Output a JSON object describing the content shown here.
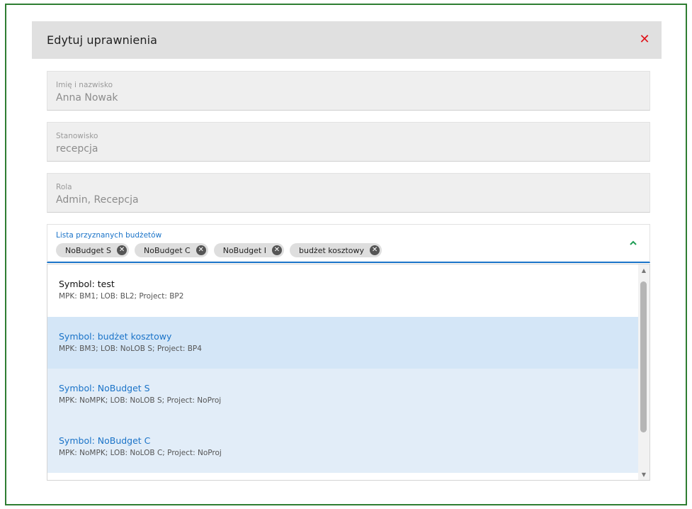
{
  "dialog": {
    "title": "Edytuj uprawnienia",
    "close_symbol": "✕"
  },
  "fields": {
    "name": {
      "label": "Imię i nazwisko",
      "value": "Anna Nowak"
    },
    "position": {
      "label": "Stanowisko",
      "value": "recepcja"
    },
    "role": {
      "label": "Rola",
      "value": "Admin, Recepcja"
    }
  },
  "budgets": {
    "label": "Lista przyznanych budżetów",
    "chips": [
      "NoBudget S",
      "NoBudget C",
      "NoBudget I",
      "budżet kosztowy"
    ],
    "remove_symbol": "✕",
    "chevron_symbol": "⌃"
  },
  "dropdown": {
    "options": [
      {
        "title": "Symbol: test",
        "detail": "MPK: BM1; LOB: BL2; Project: BP2"
      },
      {
        "title": "Symbol: budżet kosztowy",
        "detail": "MPK: BM3; LOB: NoLOB S; Project: BP4"
      },
      {
        "title": "Symbol: NoBudget S",
        "detail": "MPK: NoMPK; LOB: NoLOB S; Project: NoProj"
      },
      {
        "title": "Symbol: NoBudget C",
        "detail": "MPK: NoMPK; LOB: NoLOB C; Project: NoProj"
      }
    ],
    "scroll_up_symbol": "▲",
    "scroll_down_symbol": "▼"
  },
  "colors": {
    "accent": "#1a73c8",
    "close": "#e0131b",
    "frame": "#2e7d32",
    "chevron": "#1f9d55"
  }
}
